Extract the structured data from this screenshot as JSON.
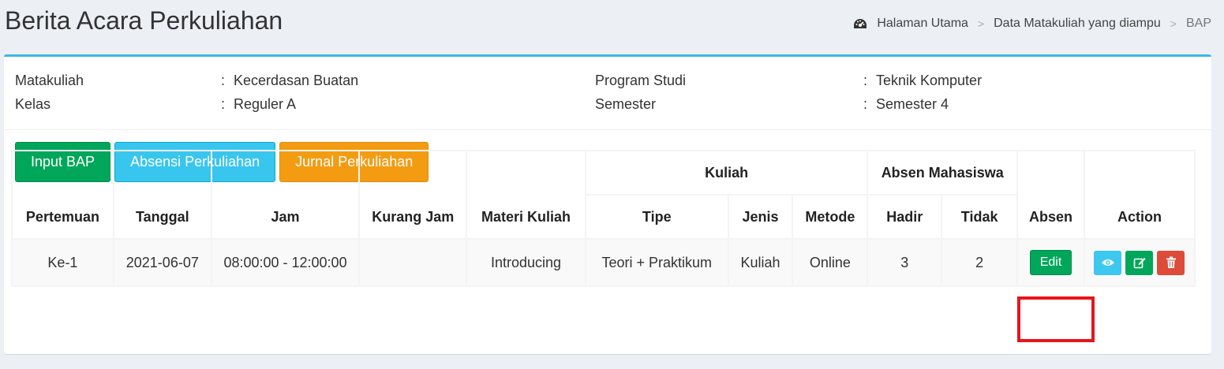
{
  "header": {
    "title": "Berita Acara Perkuliahan",
    "breadcrumb": [
      {
        "label": "Halaman Utama"
      },
      {
        "label": "Data Matakuliah yang diampu"
      },
      {
        "label": "BAP"
      }
    ],
    "breadcrumb_sep": ">",
    "breadcrumb_icon": "dashboard-icon"
  },
  "info": {
    "colon": ":",
    "matakuliah_label": "Matakuliah",
    "matakuliah_value": "Kecerdasan Buatan",
    "kelas_label": "Kelas",
    "kelas_value": "Reguler A",
    "prodi_label": "Program Studi",
    "prodi_value": "Teknik Komputer",
    "semester_label": "Semester",
    "semester_value": "Semester 4"
  },
  "buttons": {
    "input_bap": "Input BAP",
    "absensi": "Absensi Perkuliahan",
    "jurnal": "Jurnal Perkuliahan"
  },
  "table": {
    "headers": {
      "pertemuan": "Pertemuan",
      "tanggal": "Tanggal",
      "jam": "Jam",
      "kurang_jam": "Kurang Jam",
      "materi": "Materi Kuliah",
      "kuliah": "Kuliah",
      "tipe": "Tipe",
      "jenis": "Jenis",
      "metode": "Metode",
      "absen_mahasiswa": "Absen Mahasiswa",
      "hadir": "Hadir",
      "tidak": "Tidak",
      "absen": "Absen",
      "action": "Action"
    },
    "rows": [
      {
        "pertemuan": "Ke-1",
        "tanggal": "2021-06-07",
        "jam": "08:00:00 - 12:00:00",
        "kurang_jam": "",
        "materi": "Introducing",
        "tipe": "Teori + Praktikum",
        "jenis": "Kuliah",
        "metode": "Online",
        "hadir": "3",
        "tidak": "2",
        "absen_button": "Edit"
      }
    ]
  },
  "colors": {
    "accent": "#3cb7e8",
    "success": "#00a65a",
    "info": "#39c6ee",
    "warning": "#f39c12",
    "danger": "#dd4b39",
    "highlight": "#e8141b"
  }
}
